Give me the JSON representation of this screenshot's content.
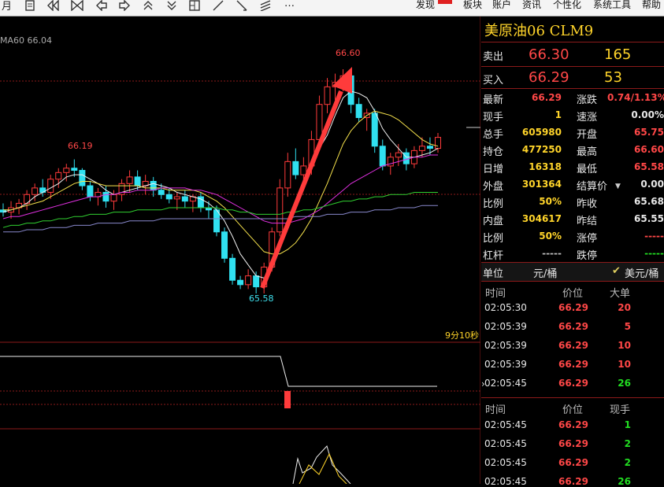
{
  "toolbar": {
    "icons": [
      "month-icon",
      "file-icon",
      "diamond-left-icon",
      "bowtie-icon",
      "arrow-left-icon",
      "arrow-right-icon",
      "double-up-icon",
      "double-down-icon",
      "grid-icon",
      "line-icon",
      "diagonal-line-icon",
      "parallel-lines-icon",
      "more-icon"
    ],
    "month_label": "月",
    "more_label": "…",
    "menu": [
      "发现",
      "板块",
      "账户",
      "资讯",
      "个性化",
      "系统工具",
      "帮助"
    ]
  },
  "chart": {
    "ma_label": "MA60 66.04",
    "high_label": "66.60",
    "low_label": "65.58",
    "local_high_label": "66.19",
    "timer_label": "9分10秒"
  },
  "quote": {
    "title": "美原油06  CLM9",
    "sell": {
      "label": "卖出",
      "price": "66.30",
      "qty": "165"
    },
    "buy": {
      "label": "买入",
      "price": "66.29",
      "qty": "53"
    },
    "rows": [
      {
        "l1": "最新",
        "v1": "66.29",
        "c1": "red",
        "l2": "涨跌",
        "v2": "0.74/1.13%",
        "c2": "red"
      },
      {
        "l1": "现手",
        "v1": "1",
        "c1": "yel",
        "l2": "速涨",
        "v2": "0.00%",
        "c2": "wht"
      },
      {
        "l1": "总手",
        "v1": "605980",
        "c1": "yel",
        "l2": "开盘",
        "v2": "65.75",
        "c2": "red"
      },
      {
        "l1": "持仓",
        "v1": "477250",
        "c1": "yel",
        "l2": "最高",
        "v2": "66.60",
        "c2": "red"
      },
      {
        "l1": "日增",
        "v1": "16318",
        "c1": "yel",
        "l2": "最低",
        "v2": "65.58",
        "c2": "red"
      },
      {
        "l1": "外盘",
        "v1": "301364",
        "c1": "yel",
        "l2": "结算价",
        "v2": "0.00",
        "c2": "wht"
      },
      {
        "l1": "比例",
        "v1": "50%",
        "c1": "yel",
        "l2": "昨收",
        "v2": "65.68",
        "c2": "wht"
      },
      {
        "l1": "内盘",
        "v1": "304617",
        "c1": "yel",
        "l2": "昨结",
        "v2": "65.55",
        "c2": "wht"
      },
      {
        "l1": "比例",
        "v1": "50%",
        "c1": "yel",
        "l2": "涨停",
        "v2": "-----",
        "c2": "red"
      },
      {
        "l1": "杠杆",
        "v1": "-----",
        "c1": "gray",
        "l2": "跌停",
        "v2": "-----",
        "c2": "grn"
      }
    ],
    "unit_label": "单位",
    "unit_value": "元/桶",
    "unit_option": "美元/桶"
  },
  "big_orders": {
    "headers": [
      "时间",
      "价位",
      "大单"
    ],
    "rows": [
      {
        "time": "02:05:30",
        "price": "66.29",
        "qty": "20",
        "c": "red"
      },
      {
        "time": "02:05:39",
        "price": "66.29",
        "qty": "5",
        "c": "red"
      },
      {
        "time": "02:05:39",
        "price": "66.29",
        "qty": "10",
        "c": "red"
      },
      {
        "time": "02:05:39",
        "price": "66.29",
        "qty": "10",
        "c": "red"
      },
      {
        "time": "02:05:45",
        "price": "66.29",
        "qty": "26",
        "c": "grn"
      }
    ]
  },
  "ticks": {
    "headers": [
      "时间",
      "价位",
      "现手"
    ],
    "rows": [
      {
        "time": "02:05:45",
        "price": "66.29",
        "qty": "1",
        "c": "grn"
      },
      {
        "time": "02:05:45",
        "price": "66.29",
        "qty": "2",
        "c": "grn"
      },
      {
        "time": "02:05:45",
        "price": "66.29",
        "qty": "2",
        "c": "grn"
      },
      {
        "time": "02:05:45",
        "price": "66.29",
        "qty": "26",
        "c": "grn"
      }
    ]
  },
  "chart_data": {
    "type": "candlestick",
    "ma_value": 66.04,
    "high": 66.6,
    "low": 65.58,
    "local_high": 66.19,
    "candles": [
      {
        "o": 65.96,
        "h": 65.99,
        "l": 65.93,
        "c": 65.95
      },
      {
        "o": 65.95,
        "h": 66.0,
        "l": 65.92,
        "c": 65.97
      },
      {
        "o": 65.97,
        "h": 66.01,
        "l": 65.94,
        "c": 65.99
      },
      {
        "o": 65.99,
        "h": 66.05,
        "l": 65.96,
        "c": 66.03
      },
      {
        "o": 66.03,
        "h": 66.08,
        "l": 66.0,
        "c": 66.06
      },
      {
        "o": 66.06,
        "h": 66.1,
        "l": 66.02,
        "c": 66.04
      },
      {
        "o": 66.04,
        "h": 66.12,
        "l": 66.01,
        "c": 66.1
      },
      {
        "o": 66.1,
        "h": 66.15,
        "l": 66.06,
        "c": 66.13
      },
      {
        "o": 66.13,
        "h": 66.17,
        "l": 66.09,
        "c": 66.15
      },
      {
        "o": 66.15,
        "h": 66.19,
        "l": 66.11,
        "c": 66.14
      },
      {
        "o": 66.14,
        "h": 66.15,
        "l": 66.05,
        "c": 66.07
      },
      {
        "o": 66.07,
        "h": 66.09,
        "l": 66.0,
        "c": 66.02
      },
      {
        "o": 66.02,
        "h": 66.06,
        "l": 65.98,
        "c": 66.04
      },
      {
        "o": 66.04,
        "h": 66.07,
        "l": 65.97,
        "c": 66.0
      },
      {
        "o": 66.0,
        "h": 66.05,
        "l": 65.96,
        "c": 66.03
      },
      {
        "o": 66.03,
        "h": 66.1,
        "l": 66.0,
        "c": 66.08
      },
      {
        "o": 66.08,
        "h": 66.14,
        "l": 66.04,
        "c": 66.11
      },
      {
        "o": 66.11,
        "h": 66.14,
        "l": 66.05,
        "c": 66.07
      },
      {
        "o": 66.07,
        "h": 66.12,
        "l": 66.03,
        "c": 66.09
      },
      {
        "o": 66.09,
        "h": 66.11,
        "l": 66.02,
        "c": 66.05
      },
      {
        "o": 66.05,
        "h": 66.08,
        "l": 66.01,
        "c": 66.03
      },
      {
        "o": 66.03,
        "h": 66.06,
        "l": 65.99,
        "c": 66.01
      },
      {
        "o": 66.01,
        "h": 66.04,
        "l": 65.96,
        "c": 66.02
      },
      {
        "o": 66.02,
        "h": 66.05,
        "l": 65.97,
        "c": 66.0
      },
      {
        "o": 66.0,
        "h": 66.03,
        "l": 65.95,
        "c": 66.02
      },
      {
        "o": 66.02,
        "h": 66.04,
        "l": 65.95,
        "c": 65.97
      },
      {
        "o": 65.97,
        "h": 66.0,
        "l": 65.92,
        "c": 65.96
      },
      {
        "o": 65.96,
        "h": 65.98,
        "l": 65.84,
        "c": 65.86
      },
      {
        "o": 65.86,
        "h": 65.88,
        "l": 65.72,
        "c": 65.74
      },
      {
        "o": 65.74,
        "h": 65.76,
        "l": 65.62,
        "c": 65.64
      },
      {
        "o": 65.64,
        "h": 65.66,
        "l": 65.6,
        "c": 65.62
      },
      {
        "o": 65.62,
        "h": 65.69,
        "l": 65.6,
        "c": 65.66
      },
      {
        "o": 65.66,
        "h": 65.68,
        "l": 65.58,
        "c": 65.61
      },
      {
        "o": 65.61,
        "h": 65.72,
        "l": 65.58,
        "c": 65.7
      },
      {
        "o": 65.7,
        "h": 65.88,
        "l": 65.68,
        "c": 65.86
      },
      {
        "o": 65.86,
        "h": 66.1,
        "l": 65.84,
        "c": 66.06
      },
      {
        "o": 66.06,
        "h": 66.22,
        "l": 66.02,
        "c": 66.18
      },
      {
        "o": 66.18,
        "h": 66.24,
        "l": 66.1,
        "c": 66.12
      },
      {
        "o": 66.12,
        "h": 66.2,
        "l": 66.08,
        "c": 66.16
      },
      {
        "o": 66.16,
        "h": 66.32,
        "l": 66.12,
        "c": 66.28
      },
      {
        "o": 66.28,
        "h": 66.48,
        "l": 66.25,
        "c": 66.44
      },
      {
        "o": 66.44,
        "h": 66.56,
        "l": 66.4,
        "c": 66.52
      },
      {
        "o": 66.52,
        "h": 66.58,
        "l": 66.46,
        "c": 66.54
      },
      {
        "o": 66.54,
        "h": 66.6,
        "l": 66.5,
        "c": 66.57
      },
      {
        "o": 66.57,
        "h": 66.58,
        "l": 66.4,
        "c": 66.44
      },
      {
        "o": 66.44,
        "h": 66.47,
        "l": 66.36,
        "c": 66.38
      },
      {
        "o": 66.38,
        "h": 66.42,
        "l": 66.32,
        "c": 66.4
      },
      {
        "o": 66.4,
        "h": 66.42,
        "l": 66.22,
        "c": 66.25
      },
      {
        "o": 66.25,
        "h": 66.28,
        "l": 66.14,
        "c": 66.16
      },
      {
        "o": 66.16,
        "h": 66.22,
        "l": 66.12,
        "c": 66.2
      },
      {
        "o": 66.2,
        "h": 66.26,
        "l": 66.16,
        "c": 66.22
      },
      {
        "o": 66.22,
        "h": 66.24,
        "l": 66.14,
        "c": 66.17
      },
      {
        "o": 66.17,
        "h": 66.25,
        "l": 66.15,
        "c": 66.23
      },
      {
        "o": 66.23,
        "h": 66.29,
        "l": 66.2,
        "c": 66.25
      },
      {
        "o": 66.25,
        "h": 66.29,
        "l": 66.21,
        "c": 66.24
      },
      {
        "o": 66.24,
        "h": 66.31,
        "l": 66.22,
        "c": 66.29
      }
    ],
    "ma_series": [
      {
        "name": "MA5",
        "color": "#f0f0f0",
        "values": [
          65.95,
          65.96,
          65.97,
          65.99,
          66.02,
          66.04,
          66.06,
          66.08,
          66.11,
          66.12,
          66.12,
          66.1,
          66.08,
          66.05,
          66.03,
          66.04,
          66.05,
          66.06,
          66.07,
          66.08,
          66.07,
          66.06,
          66.04,
          66.03,
          66.02,
          66.01,
          65.99,
          65.96,
          65.91,
          65.84,
          65.76,
          65.71,
          65.66,
          65.65,
          65.69,
          65.78,
          65.88,
          65.98,
          66.08,
          66.16,
          66.24,
          66.3,
          66.39,
          66.47,
          66.5,
          66.49,
          66.47,
          66.41,
          66.33,
          66.28,
          66.24,
          66.2,
          66.2,
          66.21,
          66.22,
          66.24
        ]
      },
      {
        "name": "MA10",
        "color": "#f5e14c",
        "values": [
          65.96,
          65.96,
          65.97,
          65.98,
          65.99,
          66.0,
          66.02,
          66.04,
          66.06,
          66.08,
          66.09,
          66.09,
          66.08,
          66.07,
          66.07,
          66.07,
          66.07,
          66.07,
          66.06,
          66.06,
          66.06,
          66.05,
          66.05,
          66.05,
          66.05,
          66.04,
          66.02,
          66.0,
          65.97,
          65.93,
          65.89,
          65.85,
          65.81,
          65.77,
          65.76,
          65.76,
          65.78,
          65.81,
          65.86,
          65.92,
          66.0,
          66.08,
          66.17,
          66.26,
          66.32,
          66.36,
          66.39,
          66.41,
          66.4,
          66.39,
          66.37,
          66.34,
          66.31,
          66.28,
          66.26,
          66.25
        ]
      },
      {
        "name": "MA20",
        "color": "#e030e0",
        "values": [
          65.92,
          65.93,
          65.93,
          65.94,
          65.95,
          65.96,
          65.97,
          65.98,
          65.99,
          66.0,
          66.01,
          66.02,
          66.02,
          66.03,
          66.03,
          66.04,
          66.04,
          66.05,
          66.05,
          66.05,
          66.06,
          66.06,
          66.06,
          66.06,
          66.05,
          66.05,
          66.04,
          66.03,
          66.01,
          65.99,
          65.97,
          65.95,
          65.93,
          65.91,
          65.9,
          65.9,
          65.9,
          65.91,
          65.92,
          65.94,
          65.96,
          65.99,
          66.02,
          66.05,
          66.08,
          66.1,
          66.12,
          66.14,
          66.16,
          66.17,
          66.18,
          66.19,
          66.2,
          66.2,
          66.21,
          66.21
        ]
      },
      {
        "name": "MA60",
        "color": "#30d030",
        "values": [
          65.88,
          65.89,
          65.89,
          65.9,
          65.9,
          65.91,
          65.91,
          65.92,
          65.92,
          65.93,
          65.93,
          65.94,
          65.94,
          65.94,
          65.95,
          65.95,
          65.95,
          65.96,
          65.96,
          65.96,
          65.96,
          65.97,
          65.97,
          65.97,
          65.97,
          65.97,
          65.97,
          65.97,
          65.96,
          65.96,
          65.95,
          65.95,
          65.94,
          65.94,
          65.94,
          65.94,
          65.95,
          65.95,
          65.96,
          65.96,
          65.97,
          65.98,
          65.99,
          66.0,
          66.0,
          66.01,
          66.01,
          66.02,
          66.02,
          66.03,
          66.03,
          66.03,
          66.04,
          66.04,
          66.04,
          66.04
        ]
      },
      {
        "name": "MA120",
        "color": "#8888cc",
        "values": [
          65.86,
          65.86,
          65.86,
          65.87,
          65.87,
          65.87,
          65.88,
          65.88,
          65.88,
          65.89,
          65.89,
          65.89,
          65.9,
          65.9,
          65.9,
          65.9,
          65.91,
          65.91,
          65.91,
          65.91,
          65.92,
          65.92,
          65.92,
          65.92,
          65.92,
          65.92,
          65.92,
          65.92,
          65.92,
          65.92,
          65.92,
          65.92,
          65.92,
          65.92,
          65.92,
          65.92,
          65.92,
          65.93,
          65.93,
          65.93,
          65.93,
          65.94,
          65.94,
          65.94,
          65.95,
          65.95,
          65.95,
          65.96,
          65.96,
          65.96,
          65.97,
          65.97,
          65.97,
          65.98,
          65.98,
          65.98
        ]
      }
    ],
    "ylim": [
      65.5,
      66.7
    ]
  }
}
